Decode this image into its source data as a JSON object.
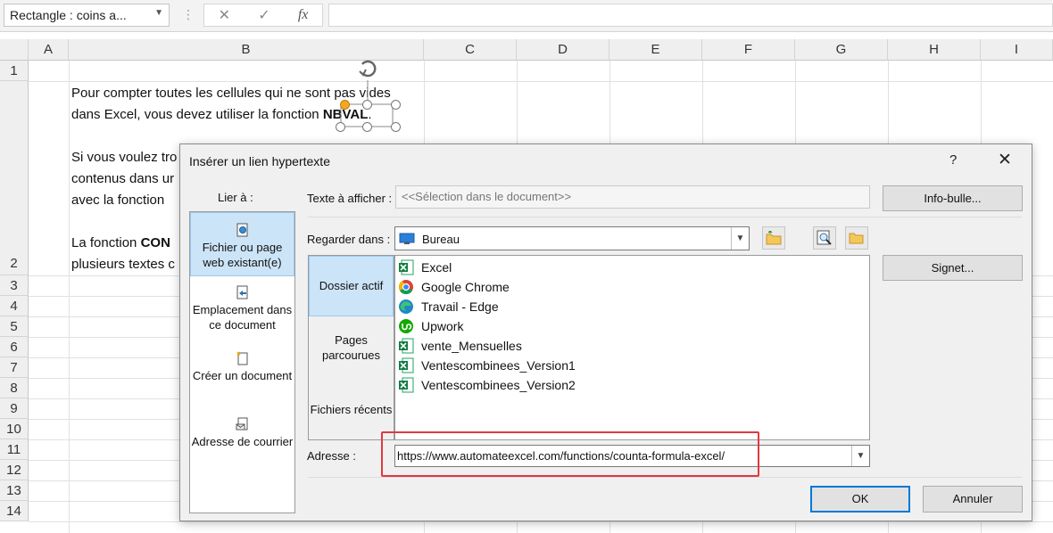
{
  "formula_bar": {
    "name_box": "Rectangle : coins a...",
    "cancel_icon": "✕",
    "enter_icon": "✓",
    "fx_label": "fx",
    "formula_value": ""
  },
  "sheet": {
    "columns": [
      "A",
      "B",
      "C",
      "D",
      "E",
      "F",
      "G",
      "H",
      "I"
    ],
    "rows": [
      "1",
      "2",
      "3",
      "4",
      "5",
      "6",
      "7",
      "8",
      "9",
      "10",
      "11",
      "12",
      "13",
      "14"
    ],
    "cell_lines": [
      "Pour compter toutes les cellules qui ne sont pas vides",
      "dans Excel, vous devez utiliser la fonction ",
      "Si vous voulez tro",
      "contenus dans ur",
      "avec la fonction",
      "La fonction ",
      "plusieurs textes c"
    ],
    "bold_nbval": "NBVAL",
    "bold_con": "CON",
    "period": "."
  },
  "dialog": {
    "title": "Insérer un lien hypertexte",
    "help_label": "?",
    "close_label": "✕",
    "link_to_label": "Lier à :",
    "link_items": [
      {
        "label": "Fichier ou page web existant(e)",
        "icon": "web-page-icon",
        "selected": true
      },
      {
        "label": "Emplacement dans ce document",
        "icon": "document-location-icon",
        "selected": false
      },
      {
        "label": "Créer un document",
        "icon": "new-document-icon",
        "selected": false
      },
      {
        "label": "Adresse de courrier",
        "icon": "email-icon",
        "selected": false
      }
    ],
    "text_to_display_label": "Texte à afficher :",
    "text_to_display_value": "<<Sélection dans le document>>",
    "screentip_button": "Info-bulle...",
    "look_in_label": "Regarder dans :",
    "look_in_value": "Bureau",
    "nav_items": [
      {
        "label": "Dossier actif",
        "selected": true
      },
      {
        "label": "Pages parcourues",
        "selected": false
      },
      {
        "label": "Fichiers récents",
        "selected": false
      }
    ],
    "files": [
      {
        "name": "Excel",
        "icon": "excel-shortcut-icon"
      },
      {
        "name": "Google Chrome",
        "icon": "chrome-icon"
      },
      {
        "name": "Travail - Edge",
        "icon": "edge-icon"
      },
      {
        "name": "Upwork",
        "icon": "upwork-icon"
      },
      {
        "name": "vente_Mensuelles",
        "icon": "excel-file-icon"
      },
      {
        "name": "Ventescombinees_Version1",
        "icon": "excel-file-icon"
      },
      {
        "name": "Ventescombinees_Version2",
        "icon": "excel-file-icon"
      }
    ],
    "bookmark_button": "Signet...",
    "address_label": "Adresse :",
    "address_value": "https://www.automateexcel.com/functions/counta-formula-excel/",
    "ok_button": "OK",
    "cancel_button": "Annuler",
    "colors": {
      "highlight": "#cce4f7",
      "annotation_red": "#e0393e",
      "ok_border": "#0078d7"
    }
  }
}
